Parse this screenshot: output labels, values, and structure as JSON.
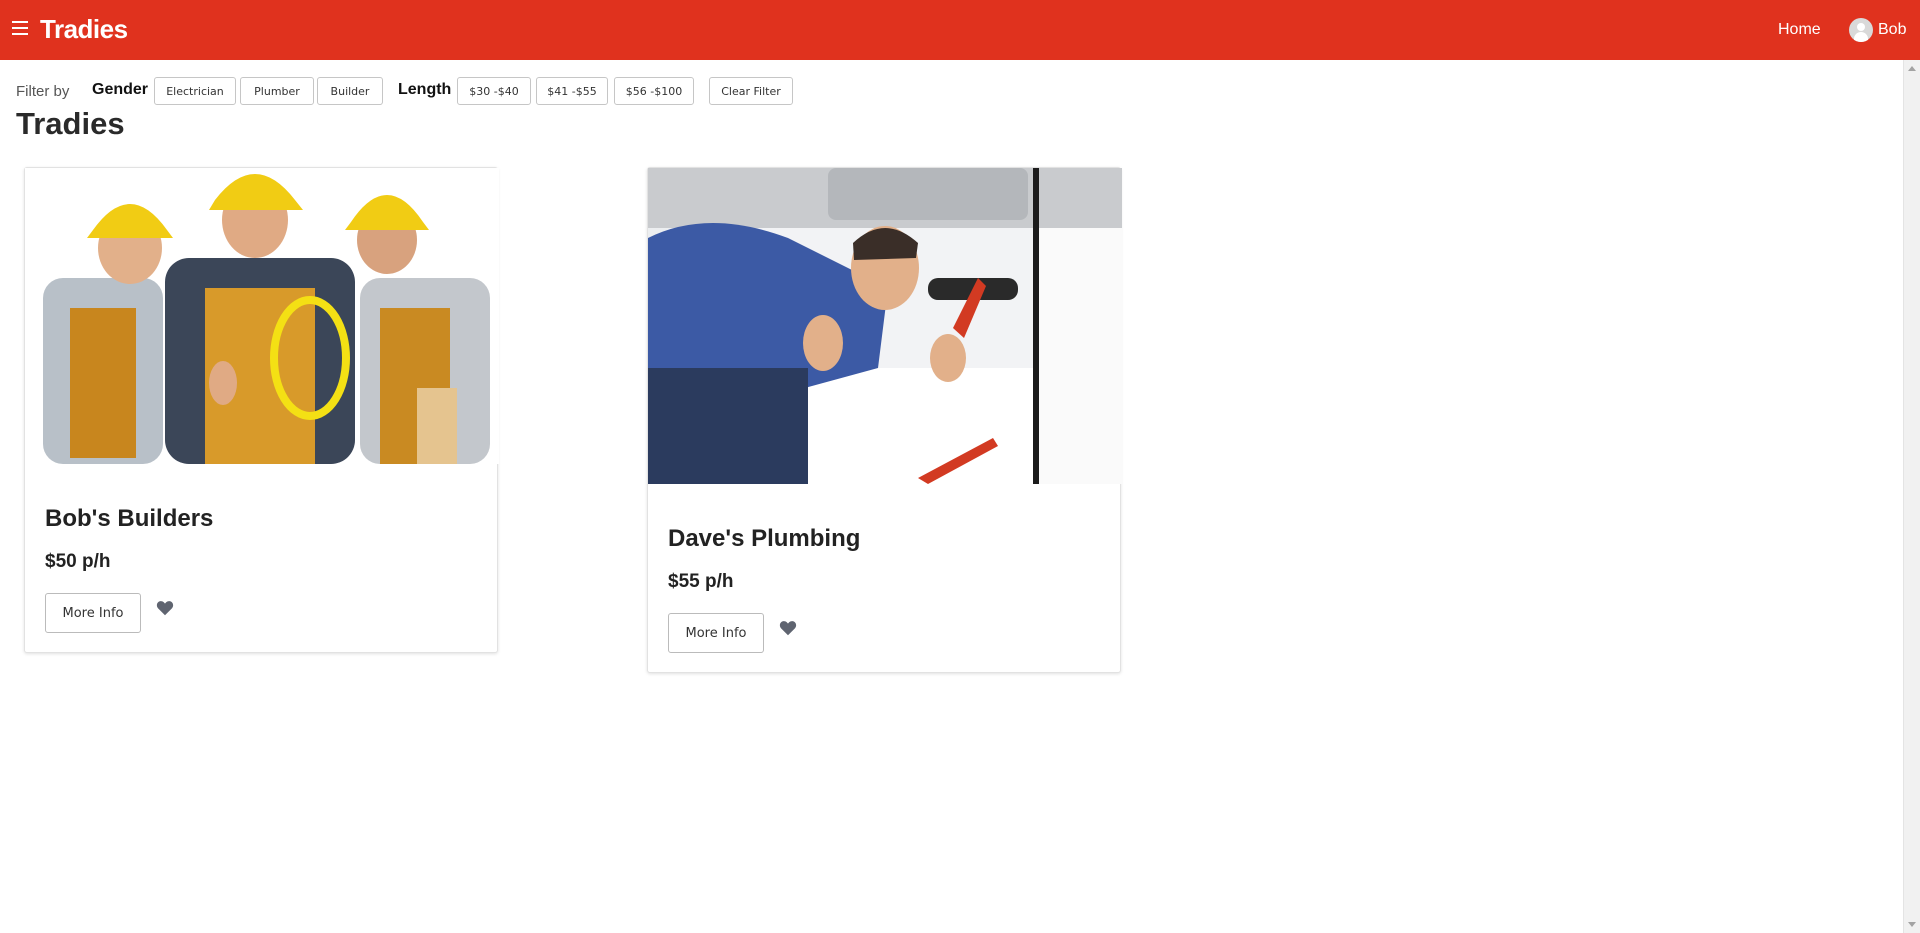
{
  "navbar": {
    "brand": "Tradies",
    "home_label": "Home",
    "user_name": "Bob",
    "accent_color": "#e0321e"
  },
  "filters": {
    "label": "Filter by",
    "gender_label": "Gender",
    "gender_options": [
      "Electrician",
      "Plumber",
      "Builder"
    ],
    "length_label": "Length",
    "length_options": [
      "$30 -$40",
      "$41 -$55",
      "$56 -$100"
    ],
    "clear_label": "Clear Filter"
  },
  "page": {
    "title": "Tradies"
  },
  "cards": [
    {
      "title": "Bob's Builders",
      "price": "$50 p/h",
      "button_label": "More Info",
      "image": "three smiling builders in yellow hard hats and overalls",
      "favorite_icon": "heart-icon"
    },
    {
      "title": "Dave's Plumbing",
      "price": "$55 p/h",
      "button_label": "More Info",
      "image": "smiling plumber under sink with red wrench",
      "favorite_icon": "heart-icon"
    }
  ]
}
